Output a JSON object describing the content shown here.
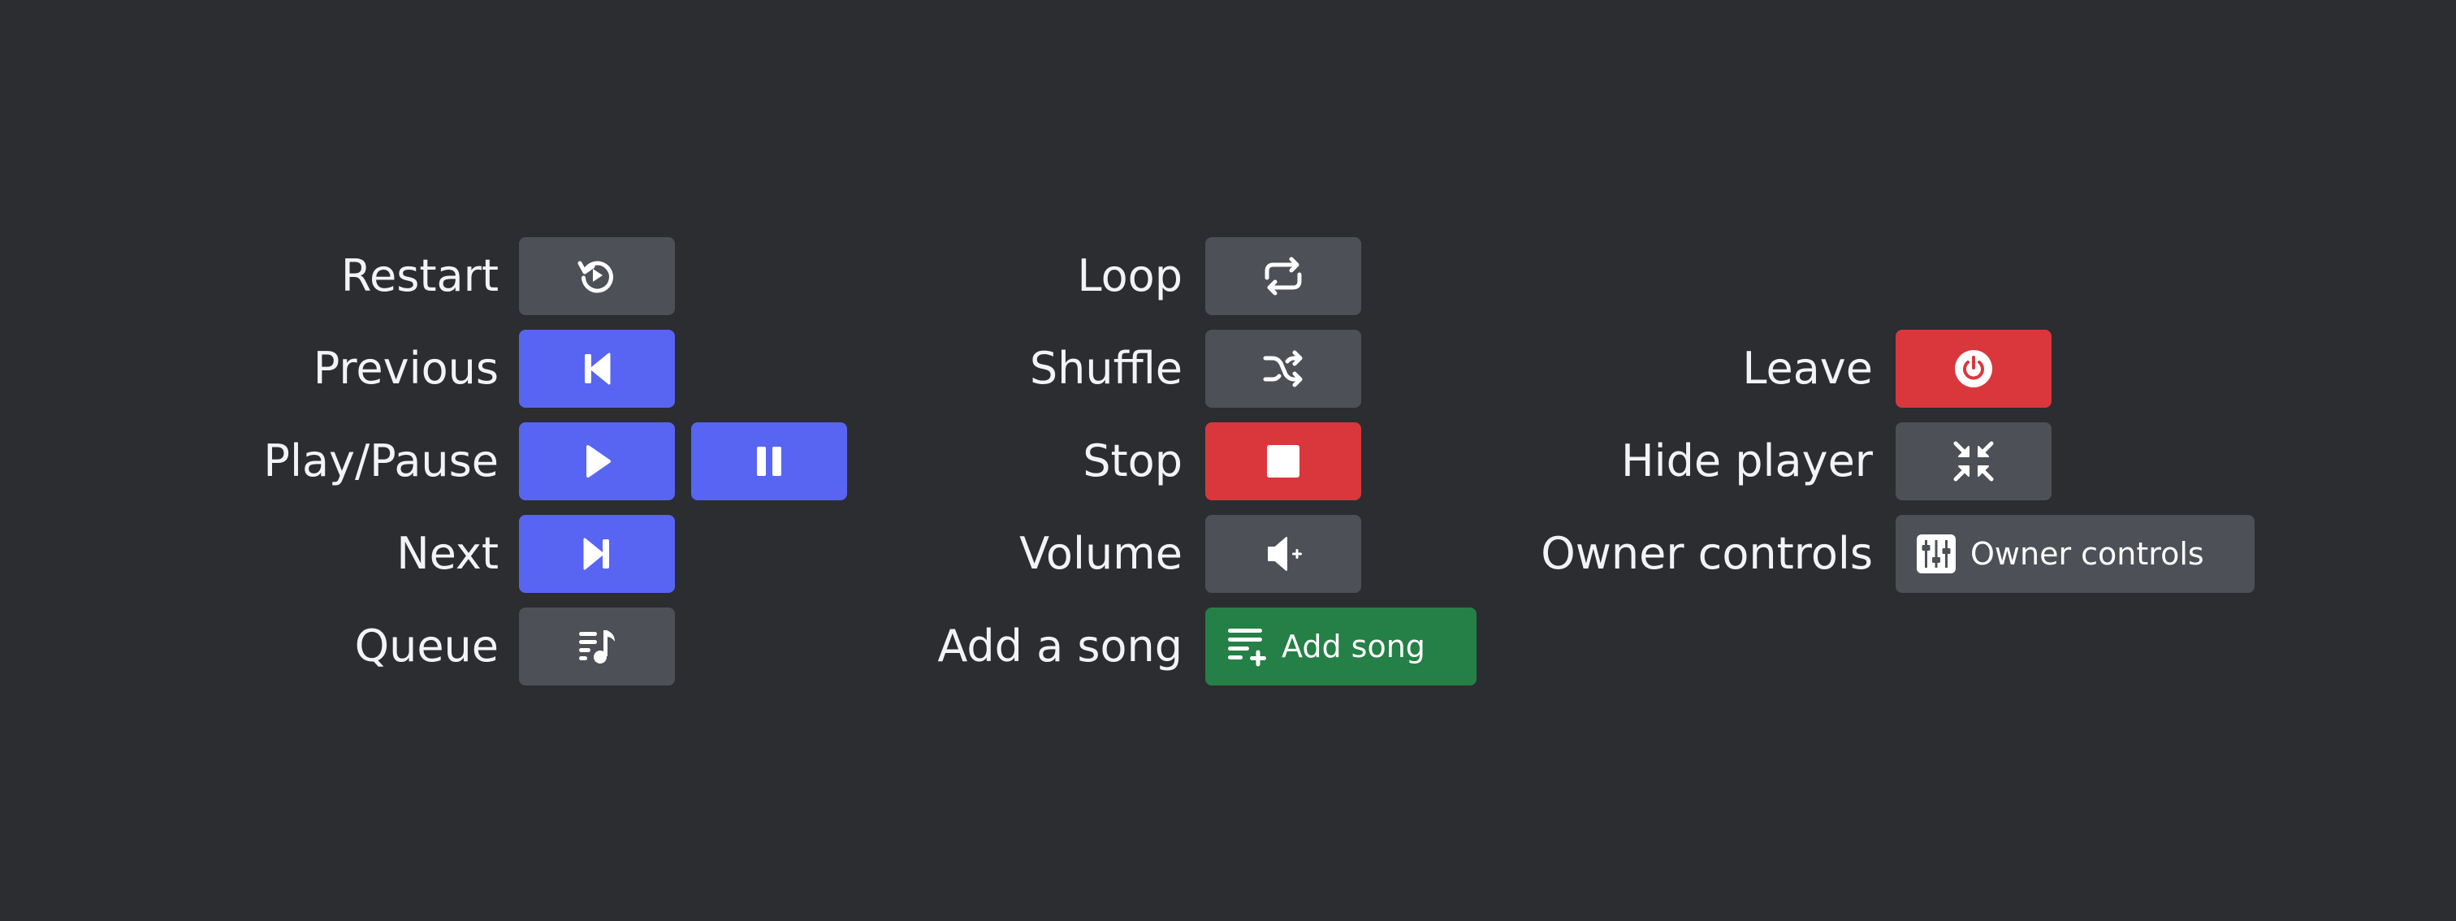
{
  "colors": {
    "background": "#2b2d31",
    "grey": "#4e5058",
    "blurple": "#5865f2",
    "red": "#da373c",
    "green": "#248046",
    "text": "#f2f3f5"
  },
  "column1": {
    "restart": {
      "label": "Restart",
      "icon": "restart-icon"
    },
    "previous": {
      "label": "Previous",
      "icon": "previous-track-icon"
    },
    "play_pause": {
      "label": "Play/Pause",
      "play_icon": "play-icon",
      "pause_icon": "pause-icon"
    },
    "next": {
      "label": "Next",
      "icon": "next-track-icon"
    },
    "queue": {
      "label": "Queue",
      "icon": "queue-music-icon"
    }
  },
  "column2": {
    "loop": {
      "label": "Loop",
      "icon": "loop-icon"
    },
    "shuffle": {
      "label": "Shuffle",
      "icon": "shuffle-icon"
    },
    "stop": {
      "label": "Stop",
      "icon": "stop-icon"
    },
    "volume": {
      "label": "Volume",
      "icon": "volume-icon"
    },
    "add_song": {
      "label": "Add a song",
      "button_label": "Add song",
      "icon": "playlist-add-icon"
    }
  },
  "column3": {
    "leave": {
      "label": "Leave",
      "icon": "power-icon"
    },
    "hide_player": {
      "label": "Hide player",
      "icon": "minimize-icon"
    },
    "owner_controls": {
      "label": "Owner controls",
      "button_label": "Owner controls",
      "icon": "sliders-icon"
    }
  }
}
